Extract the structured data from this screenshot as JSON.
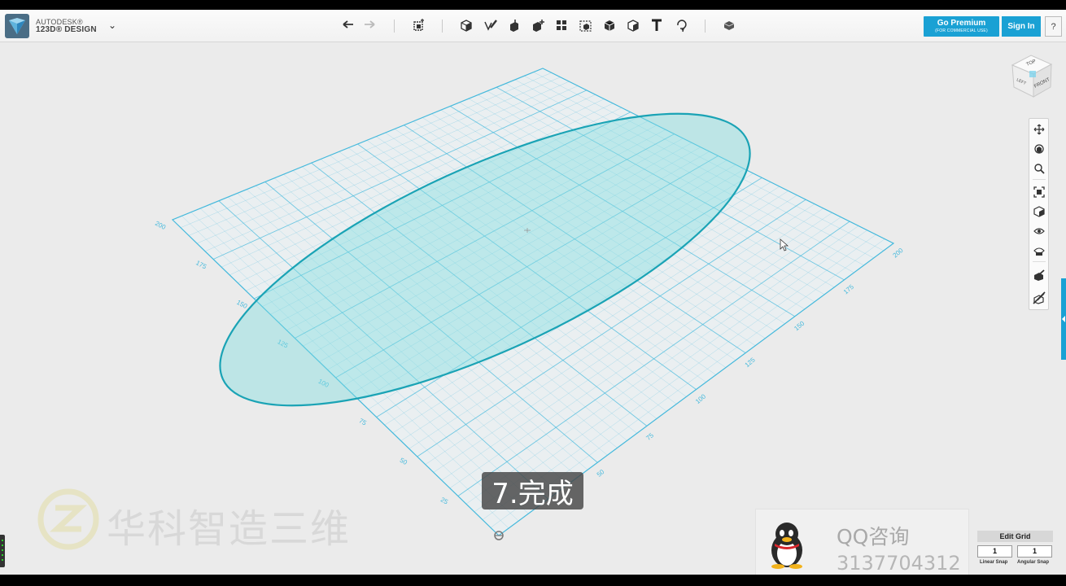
{
  "app": {
    "brand_line1": "AUTODESK®",
    "brand_line2": "123D® DESIGN",
    "brand_menu_icon": "chevron-down-icon"
  },
  "toolbar": {
    "tools": [
      {
        "name": "undo",
        "icon": "undo-icon"
      },
      {
        "name": "redo",
        "icon": "redo-icon"
      },
      {
        "name": "transform",
        "icon": "transform-icon"
      },
      {
        "name": "primitives",
        "icon": "primitives-icon"
      },
      {
        "name": "sketch",
        "icon": "sketch-icon"
      },
      {
        "name": "construct",
        "icon": "construct-icon"
      },
      {
        "name": "modify",
        "icon": "modify-icon"
      },
      {
        "name": "pattern",
        "icon": "pattern-icon"
      },
      {
        "name": "grouping",
        "icon": "grouping-icon"
      },
      {
        "name": "combine",
        "icon": "combine-icon"
      },
      {
        "name": "measure",
        "icon": "measure-icon"
      },
      {
        "name": "text",
        "icon": "text-icon"
      },
      {
        "name": "snap",
        "icon": "snap-icon"
      },
      {
        "name": "material",
        "icon": "material-icon"
      }
    ],
    "premium_label": "Go Premium",
    "premium_sub": "(FOR COMMERCIAL USE)",
    "signin_label": "Sign In",
    "help_label": "?"
  },
  "viewcube": {
    "top": "TOP",
    "left": "LEFT",
    "front": "FRONT"
  },
  "nav_tools": [
    {
      "name": "pan",
      "icon": "pan-icon"
    },
    {
      "name": "orbit",
      "icon": "orbit-icon"
    },
    {
      "name": "zoom",
      "icon": "zoom-icon"
    },
    {
      "name": "fit",
      "icon": "fit-icon"
    },
    {
      "name": "view-mode",
      "icon": "view-mode-icon"
    },
    {
      "name": "visibility",
      "icon": "eye-icon"
    },
    {
      "name": "materials-outline",
      "icon": "materials-outline-icon"
    },
    {
      "name": "show-all",
      "icon": "show-all-icon"
    },
    {
      "name": "hide-sketch",
      "icon": "hide-sketch-icon"
    }
  ],
  "grid": {
    "left_ticks": [
      "200",
      "175",
      "150",
      "125",
      "100",
      "75",
      "50",
      "25"
    ],
    "right_ticks": [
      "200",
      "175",
      "150",
      "125",
      "100",
      "75",
      "50"
    ],
    "accent": "#45b9dc",
    "ellipse_fill": "#7fdde0",
    "ellipse_stroke": "#1aa3b5"
  },
  "caption": "7.完成",
  "watermark": {
    "text": "华科智造三维",
    "logo_icon": "z-logo-icon"
  },
  "contact": {
    "title": "QQ咨询",
    "number": "3137704312",
    "icon": "qq-penguin-icon"
  },
  "edit_grid": {
    "title": "Edit Grid",
    "linear_value": "1",
    "angular_value": "1",
    "linear_label": "Linear Snap",
    "angular_label": "Angular Snap"
  }
}
